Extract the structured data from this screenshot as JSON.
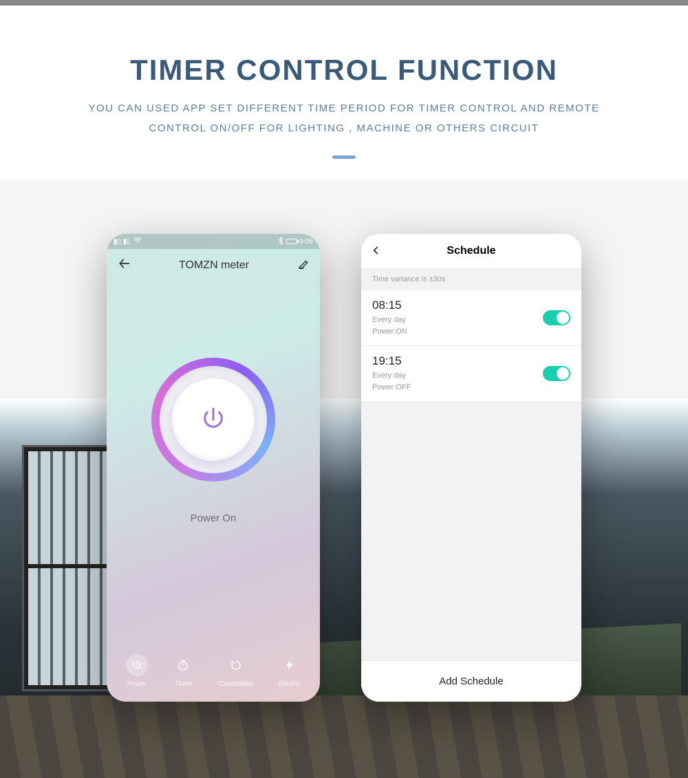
{
  "hero": {
    "title": "TIMER CONTROL FUNCTION",
    "subtitle": "YOU CAN USED APP SET DIFFERENT TIME PERIOD FOR TIMER CONTROL AND REMOTE CONTROL ON/OFF FOR LIGHTING , MACHINE OR OTHERS CIRCUIT"
  },
  "phone1": {
    "status_time": "9:06",
    "app_title": "TOMZN meter",
    "power_label": "Power On",
    "tabs": [
      {
        "label": "Power"
      },
      {
        "label": "Timer"
      },
      {
        "label": "Countdown"
      },
      {
        "label": "Electric"
      }
    ]
  },
  "phone2": {
    "title": "Schedule",
    "note": "Time variance is ±30s",
    "items": [
      {
        "time": "08:15",
        "repeat": "Every day",
        "power": "Power:ON",
        "on": true
      },
      {
        "time": "19:15",
        "repeat": "Every day",
        "power": "Power:OFF",
        "on": true
      }
    ],
    "footer": "Add Schedule"
  }
}
